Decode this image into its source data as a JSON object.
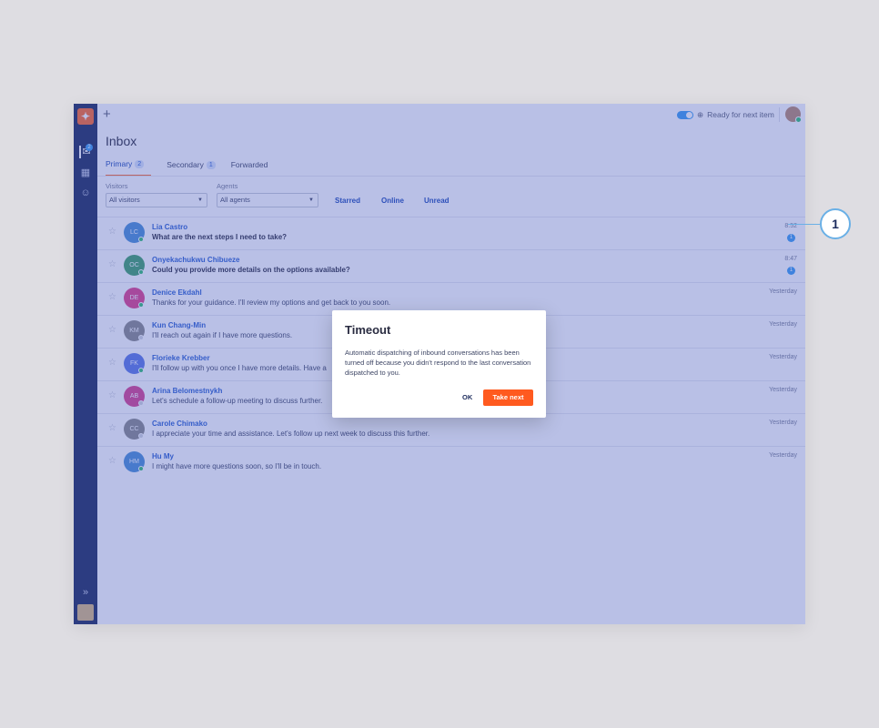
{
  "topbar": {
    "ready_label": "Ready for next item"
  },
  "rail": {
    "badge": "2"
  },
  "title": "Inbox",
  "tabs": [
    {
      "label": "Primary",
      "count": "2"
    },
    {
      "label": "Secondary",
      "count": "1"
    },
    {
      "label": "Forwarded",
      "count": ""
    }
  ],
  "filters": {
    "visitors_label": "Visitors",
    "visitors_value": "All visitors",
    "agents_label": "Agents",
    "agents_value": "All agents",
    "quick": [
      "Starred",
      "Online",
      "Unread"
    ]
  },
  "conversations": [
    {
      "initials": "LC",
      "color": "#4a8fd6",
      "online": true,
      "name": "Lia Castro",
      "message": "What are the next steps I need to take?",
      "time": "8:52",
      "count": "1",
      "unread": true
    },
    {
      "initials": "OC",
      "color": "#3ea06a",
      "online": true,
      "name": "Onyekachukwu Chibueze",
      "message": "Could you provide more details on the options available?",
      "time": "8:47",
      "count": "1",
      "unread": true
    },
    {
      "initials": "DE",
      "color": "#e0408a",
      "online": true,
      "name": "Denice Ekdahl",
      "message": "Thanks for your guidance. I'll review my options and get back to you soon.",
      "time": "Yesterday",
      "count": "",
      "unread": false
    },
    {
      "initials": "KM",
      "color": "#8a8a8a",
      "online": false,
      "name": "Kun Chang-Min",
      "message": "I'll reach out again if I have more questions.",
      "time": "Yesterday",
      "count": "",
      "unread": false
    },
    {
      "initials": "FK",
      "color": "#5b78e6",
      "online": true,
      "name": "Florieke Krebber",
      "message": "I'll follow up with you once I have more details. Have a",
      "time": "Yesterday",
      "count": "",
      "unread": false
    },
    {
      "initials": "AB",
      "color": "#d9418f",
      "online": false,
      "name": "Arina Belomestnykh",
      "message": "Let's schedule a follow-up meeting to discuss further.",
      "time": "Yesterday",
      "count": "",
      "unread": false
    },
    {
      "initials": "CC",
      "color": "#8a8a8a",
      "online": false,
      "name": "Carole Chimako",
      "message": "I appreciate your time and assistance. Let's follow up next week to discuss this further.",
      "time": "Yesterday",
      "count": "",
      "unread": false
    },
    {
      "initials": "HM",
      "color": "#4a8fd6",
      "online": true,
      "name": "Hu My",
      "message": "I might have more questions soon, so I'll be in touch.",
      "time": "Yesterday",
      "count": "",
      "unread": false
    }
  ],
  "modal": {
    "title": "Timeout",
    "body": "Automatic dispatching of inbound conversations has been turned off because you didn't respond to the last conversation dispatched to you.",
    "ok_label": "OK",
    "next_label": "Take next"
  },
  "callout": {
    "number": "1"
  }
}
